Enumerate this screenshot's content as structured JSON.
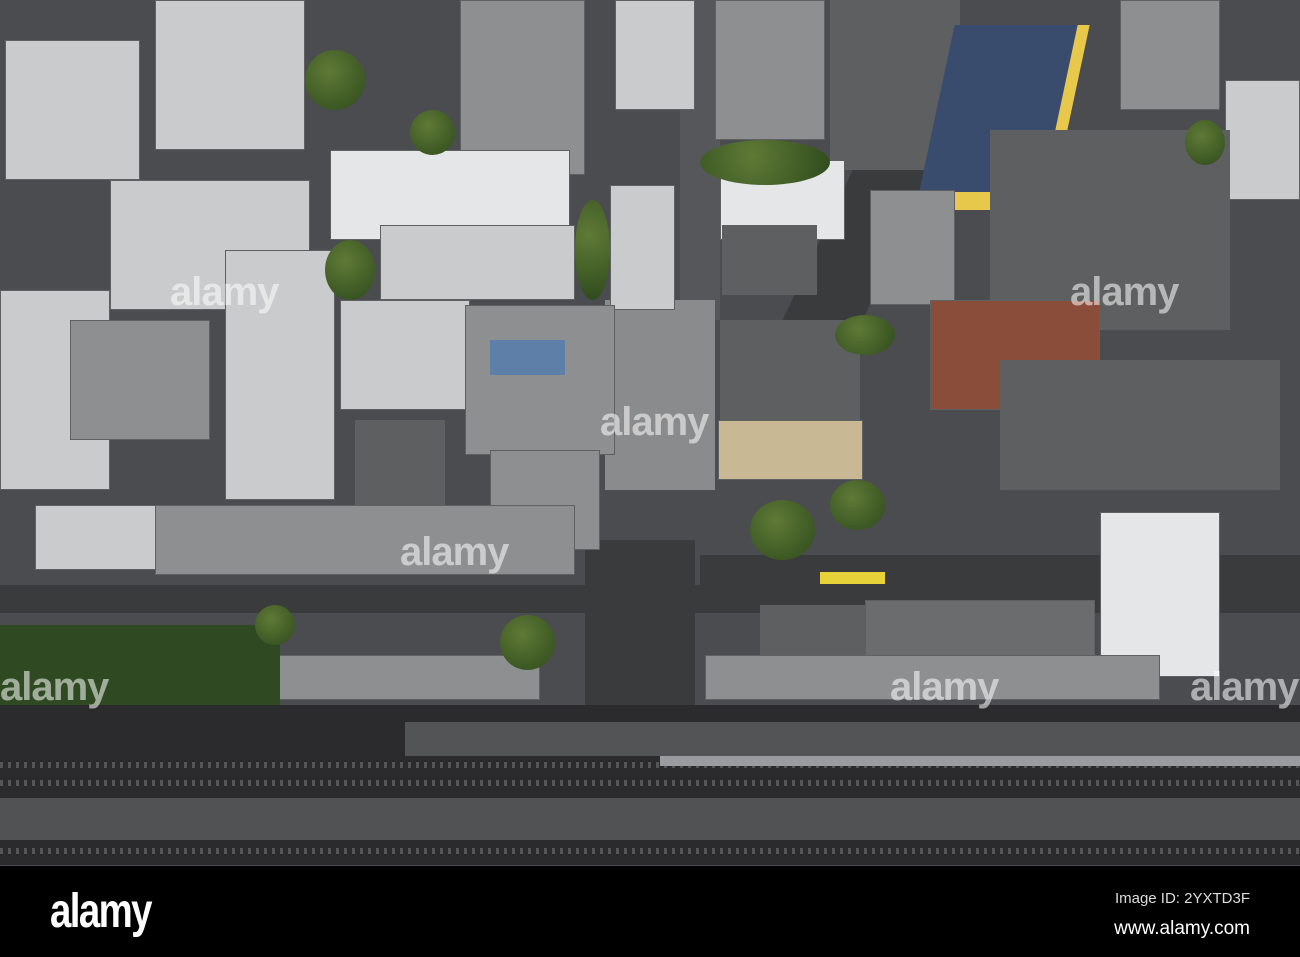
{
  "photo": {
    "subject": "aerial-city-railway",
    "accent_colors": {
      "solar_roof": "#3a4c6e",
      "yellow_facade": "#e8c84a",
      "tree": "#3d5a26",
      "track": "#2b2b2d"
    }
  },
  "watermarks": [
    "alamy",
    "alamy",
    "alamy",
    "alamy",
    "alamy",
    "alamy",
    "alamy"
  ],
  "footer": {
    "logo": "alamy",
    "image_id": "Image ID: 2YXTD3F",
    "url": "www.alamy.com"
  }
}
